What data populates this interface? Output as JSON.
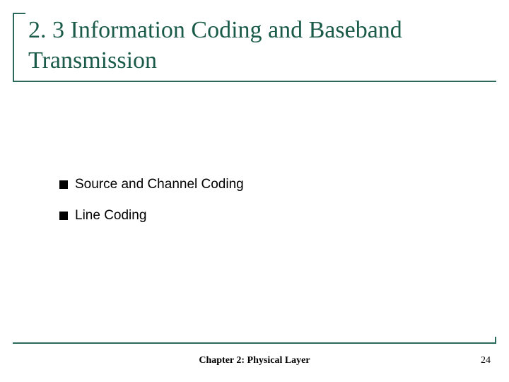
{
  "title": "2. 3 Information Coding and Baseband Transmission",
  "bullets": [
    "Source and Channel Coding",
    "Line Coding"
  ],
  "footer": "Chapter 2: Physical Layer",
  "page_number": "24",
  "colors": {
    "accent": "#2a6a5a",
    "title_text": "#1a5a48"
  }
}
